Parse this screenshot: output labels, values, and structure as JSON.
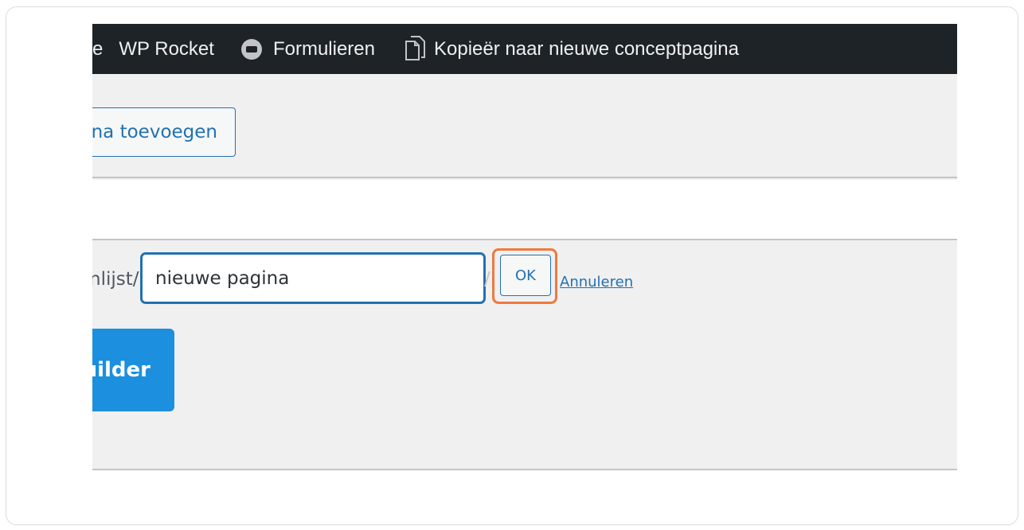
{
  "admin_bar": {
    "partial_item": "e",
    "wp_rocket": "WP Rocket",
    "forms": "Formulieren",
    "copy_to_draft": "Kopieër naar nieuwe conceptpagina"
  },
  "toolbar": {
    "add_page_label": "na toevoegen"
  },
  "permalink": {
    "prefix": "nlijst/",
    "slug_value": "nieuwe pagina",
    "suffix": "/",
    "ok_label": "OK",
    "cancel_label": "Annuleren"
  },
  "builder_button": {
    "label": "uilder"
  },
  "colors": {
    "admin_bar_bg": "#1d2327",
    "link_blue": "#2271b1",
    "highlight_orange": "#f0793f",
    "builder_blue": "#1c8fde"
  }
}
